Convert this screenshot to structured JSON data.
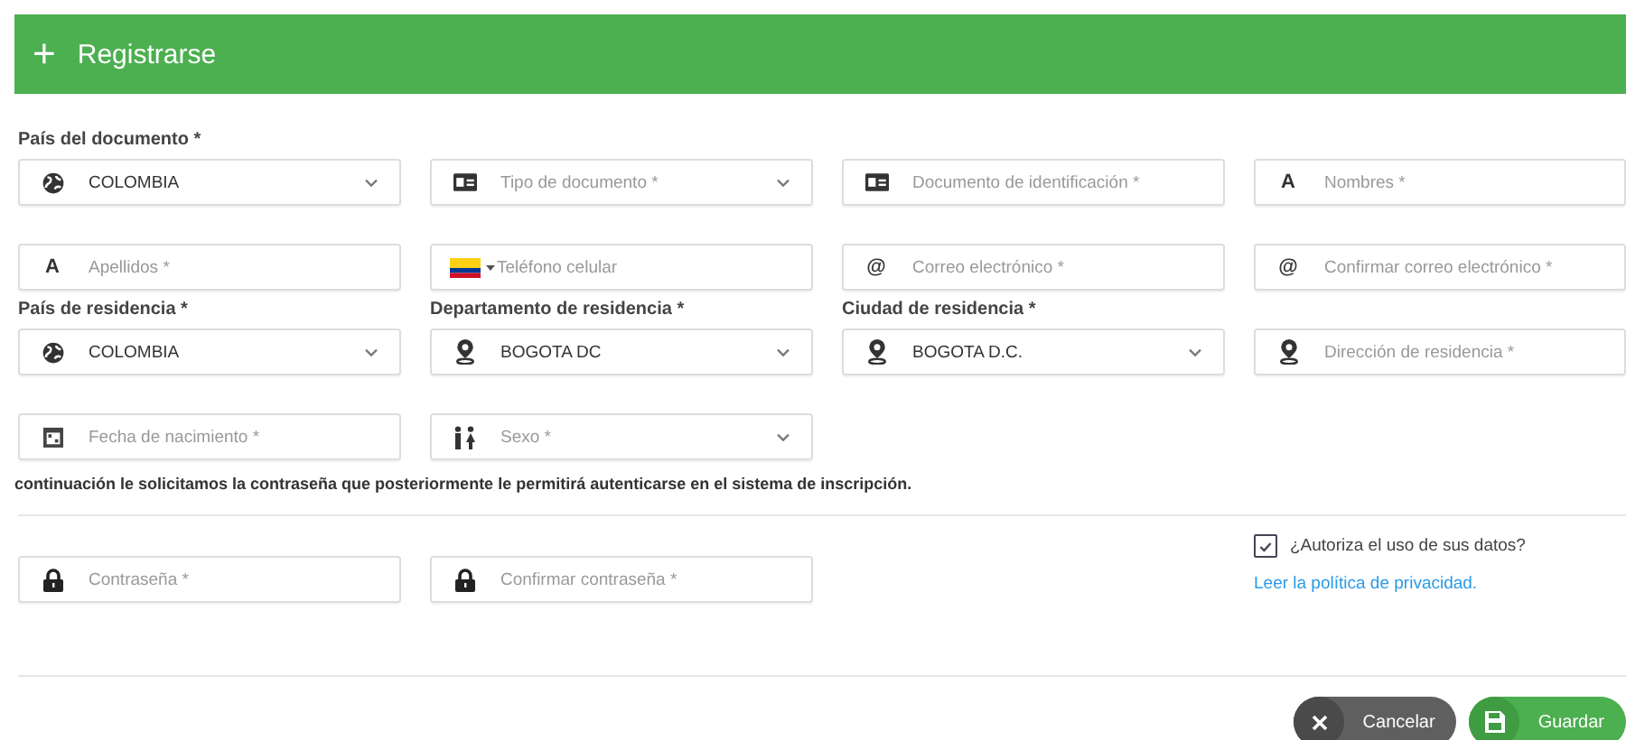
{
  "header": {
    "icon_char": "+",
    "title": "Registrarse"
  },
  "fields": [
    {
      "kind": "select",
      "label": "País del documento *",
      "value": "COLOMBIA"
    },
    {
      "kind": "select",
      "placeholder": "Tipo de documento *"
    },
    {
      "kind": "input",
      "placeholder": "Documento de identificación *"
    },
    {
      "kind": "input",
      "icon_char": "A",
      "placeholder": "Nombres *"
    },
    {
      "kind": "input",
      "icon_char": "A",
      "placeholder": "Apellidos *"
    },
    {
      "kind": "phone",
      "placeholder": "Teléfono celular"
    },
    {
      "kind": "input",
      "icon_char": "@",
      "placeholder": "Correo electrónico *"
    },
    {
      "kind": "input",
      "icon_char": "@",
      "placeholder": "Confirmar correo electrónico *"
    },
    {
      "kind": "select",
      "label": "País de residencia *",
      "value": "COLOMBIA"
    },
    {
      "kind": "select",
      "label": "Departamento de residencia *",
      "value": "BOGOTA DC"
    },
    {
      "kind": "select",
      "label": "Ciudad de residencia *",
      "value": "BOGOTA D.C."
    },
    {
      "kind": "input",
      "placeholder": "Dirección de residencia *"
    },
    {
      "kind": "input",
      "placeholder": "Fecha de nacimiento *"
    },
    {
      "kind": "select",
      "placeholder": "Sexo *"
    }
  ],
  "password_note": "continuación le solicitamos la contraseña que posteriormente le permitirá autenticarse en el sistema de inscripción.",
  "password_fields": [
    {
      "kind": "input",
      "placeholder": "Contraseña *"
    },
    {
      "kind": "input",
      "placeholder": "Confirmar contraseña *"
    }
  ],
  "consent": {
    "checked": true,
    "label": "¿Autoriza el uso de sus datos?",
    "link": "Leer la política de privacidad."
  },
  "buttons": [
    {
      "kind": "cancel",
      "label": "Cancelar"
    },
    {
      "kind": "save",
      "label": "Guardar"
    }
  ]
}
